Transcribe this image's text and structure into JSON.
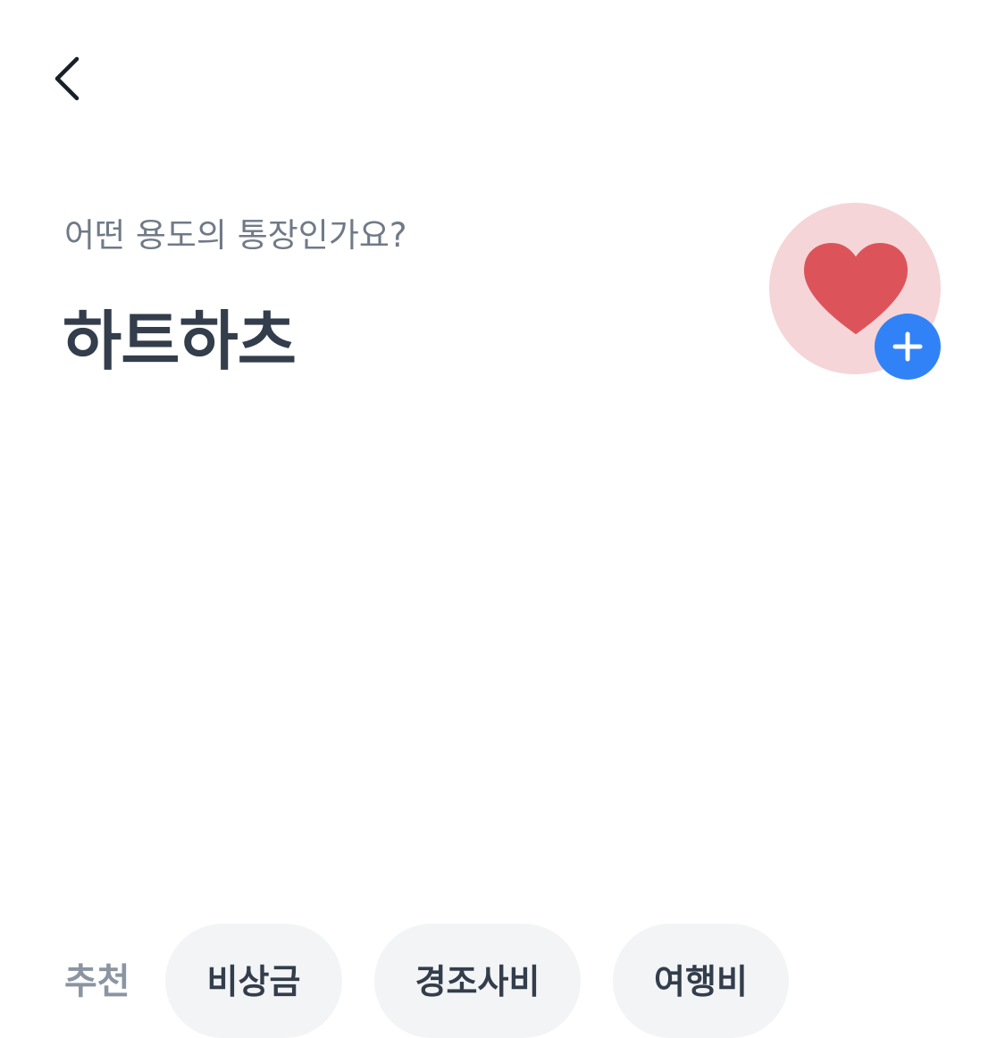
{
  "header": {
    "back_icon": "chevron-left-icon"
  },
  "prompt": {
    "question": "어떤 용도의 통장인가요?",
    "account_name": "하트하츠"
  },
  "account_icon": {
    "icon": "heart-icon",
    "badge_icon": "plus-icon",
    "circle_color": "#f5d5d8",
    "heart_color": "#dc545a",
    "badge_color": "#3182f6"
  },
  "recommend": {
    "label": "추천",
    "chips": [
      {
        "label": "비상금"
      },
      {
        "label": "경조사비"
      },
      {
        "label": "여행비"
      }
    ]
  },
  "colors": {
    "title": "#333d4b",
    "subtitle": "#707a87",
    "chip_bg": "#f2f4f6",
    "rec_label": "#8b95a1"
  }
}
